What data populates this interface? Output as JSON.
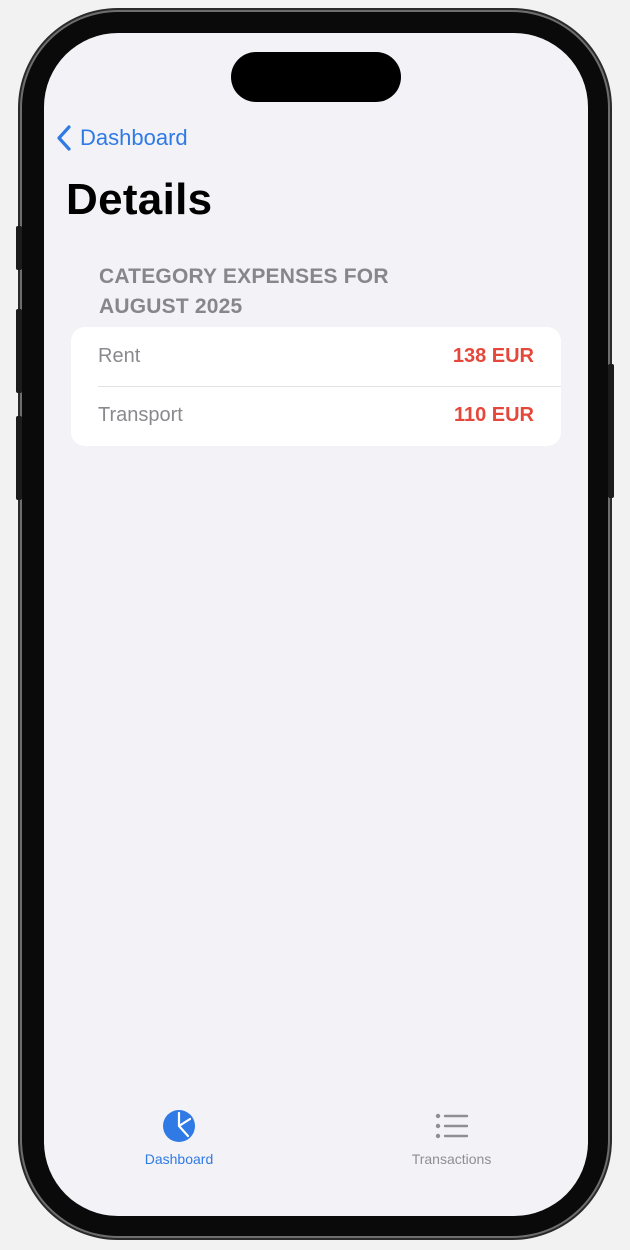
{
  "nav": {
    "back_label": "Dashboard",
    "title": "Details"
  },
  "section": {
    "header": "CATEGORY EXPENSES FOR AUGUST 2025",
    "rows": [
      {
        "label": "Rent",
        "amount": "138 EUR"
      },
      {
        "label": "Transport",
        "amount": "110 EUR"
      }
    ]
  },
  "tabbar": {
    "tabs": [
      {
        "label": "Dashboard",
        "icon": "pie-chart-icon",
        "selected": true
      },
      {
        "label": "Transactions",
        "icon": "list-icon",
        "selected": false
      }
    ]
  },
  "colors": {
    "accent": "#2f7ae5",
    "expense": "#e5483b",
    "background": "#f2f2f7",
    "secondary_text": "#86868b"
  }
}
